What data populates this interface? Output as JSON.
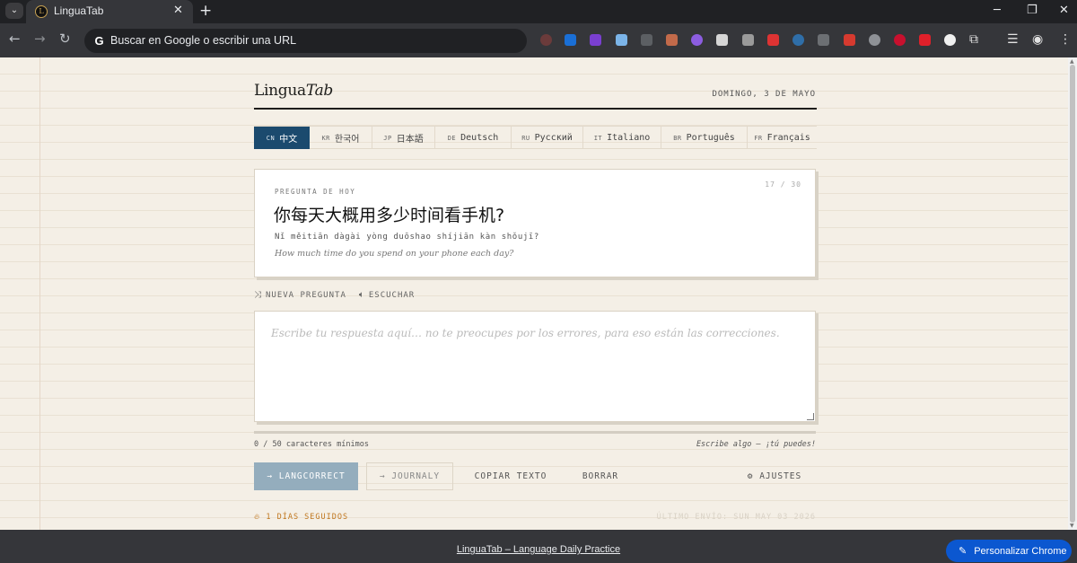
{
  "browser": {
    "tab_title": "LinguaTab",
    "omnibox_placeholder": "Buscar en Google o escribir una URL",
    "footer_link": "LinguaTab – Language Daily Practice",
    "customize_label": "Personalizar Chrome"
  },
  "app": {
    "logo_main": "Lingua",
    "logo_italic": "Tab",
    "date": "DOMINGO, 3 DE MAYO"
  },
  "languages": [
    {
      "code": "CN",
      "name": "中文",
      "active": true
    },
    {
      "code": "KR",
      "name": "한국어",
      "active": false
    },
    {
      "code": "JP",
      "name": "日本語",
      "active": false
    },
    {
      "code": "DE",
      "name": "Deutsch",
      "active": false
    },
    {
      "code": "RU",
      "name": "Русский",
      "active": false
    },
    {
      "code": "IT",
      "name": "Italiano",
      "active": false
    },
    {
      "code": "BR",
      "name": "Português",
      "active": false
    },
    {
      "code": "FR",
      "name": "Français",
      "active": false
    }
  ],
  "question": {
    "label": "PREGUNTA DE HOY",
    "counter": "17 / 30",
    "text": "你每天大概用多少时间看手机?",
    "pinyin": "Nǐ měitiān dàgài yòng duōshao shíjiān kàn shǒujī?",
    "translation": "How much time do you spend on your phone each day?"
  },
  "question_actions": {
    "new_question": "NUEVA PREGUNTA",
    "listen": "ESCUCHAR"
  },
  "answer": {
    "value": "",
    "placeholder": "Escribe tu respuesta aquí… no te preocupes por los errores, para eso están las correcciones.",
    "progress_fraction": 0,
    "char_count": "0 / 50 caracteres mínimos",
    "hint": "Escribe algo — ¡tú puedes!"
  },
  "buttons": {
    "langcorrect": "→ LANGCORRECT",
    "journaly": "→ JOURNALY",
    "copy": "COPIAR TEXTO",
    "clear": "BORRAR",
    "settings": "⚙ AJUSTES"
  },
  "status": {
    "streak": "1 DÍAS SEGUIDOS",
    "last_sent": "ÚLTIMO ENVÍO: SUN MAY 03 2026"
  },
  "colors": {
    "accent": "#1b4a6e",
    "primary_button": "#94adbd",
    "streak": "#c0771f",
    "page_bg": "#f4efe6"
  }
}
